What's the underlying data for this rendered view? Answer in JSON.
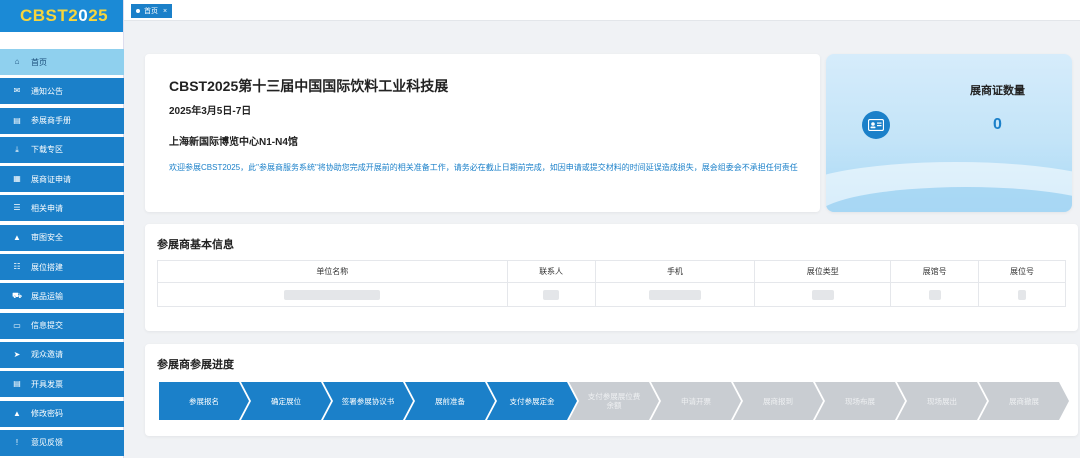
{
  "logo": {
    "main": "CBST2",
    "alt": "0",
    "rest": "25"
  },
  "sidebar": {
    "items": [
      {
        "label": "首页",
        "icon": "home-icon",
        "glyph": "⌂",
        "active": true
      },
      {
        "label": "通知公告",
        "icon": "mail-icon",
        "glyph": "✉"
      },
      {
        "label": "参展商手册",
        "icon": "book-icon",
        "glyph": "▤"
      },
      {
        "label": "下载专区",
        "icon": "download-icon",
        "glyph": "⤓"
      },
      {
        "label": "展商证申请",
        "icon": "document-icon",
        "glyph": "▦"
      },
      {
        "label": "相关申请",
        "icon": "list-icon",
        "glyph": "☰"
      },
      {
        "label": "审图安全",
        "icon": "lock-icon",
        "glyph": "▲"
      },
      {
        "label": "展位搭建",
        "icon": "checklist-icon",
        "glyph": "☷"
      },
      {
        "label": "展品运输",
        "icon": "truck-icon",
        "glyph": "⛟"
      },
      {
        "label": "信息提交",
        "icon": "monitor-icon",
        "glyph": "▭"
      },
      {
        "label": "观众邀请",
        "icon": "send-icon",
        "glyph": "➤"
      },
      {
        "label": "开具发票",
        "icon": "invoice-icon",
        "glyph": "▤"
      },
      {
        "label": "修改密码",
        "icon": "lock-icon",
        "glyph": "▲"
      },
      {
        "label": "意见反馈",
        "icon": "alert-icon",
        "glyph": "!"
      }
    ]
  },
  "tabs": [
    {
      "label": "首页",
      "close": "×"
    }
  ],
  "expo": {
    "title": "CBST2025第十三届中国国际饮料工业科技展",
    "date": "2025年3月5日-7日",
    "venue": "上海新国际博览中心N1-N4馆",
    "notice": "欢迎参展CBST2025，此\"参展商服务系统\"将协助您完成开展前的相关准备工作，请务必在截止日期前完成，如因申请或提交材料的时间延误造成损失，展会组委会不承担任何责任"
  },
  "stat": {
    "label": "展商证数量",
    "value": "0",
    "icon": "id-card-icon"
  },
  "basic_info": {
    "title": "参展商基本信息",
    "columns": [
      "单位名称",
      "联系人",
      "手机",
      "展位类型",
      "展馆号",
      "展位号"
    ]
  },
  "progress": {
    "title": "参展商参展进度",
    "steps": [
      {
        "label": "参展报名",
        "done": true
      },
      {
        "label": "确定展位",
        "done": true
      },
      {
        "label": "签署参展协议书",
        "done": true
      },
      {
        "label": "展前准备",
        "done": true
      },
      {
        "label": "支付参展定金",
        "done": true
      },
      {
        "label": "支付参展展位费余额",
        "done": false
      },
      {
        "label": "申请开票",
        "done": false
      },
      {
        "label": "展商报到",
        "done": false
      },
      {
        "label": "现场布展",
        "done": false
      },
      {
        "label": "现场展出",
        "done": false
      },
      {
        "label": "展商撤展",
        "done": false
      }
    ]
  },
  "colors": {
    "primary": "#1b80c9",
    "sidebar_active": "#8fd0ee",
    "pending_step": "#c9cdd2",
    "logo_yellow": "#f7d53c"
  }
}
